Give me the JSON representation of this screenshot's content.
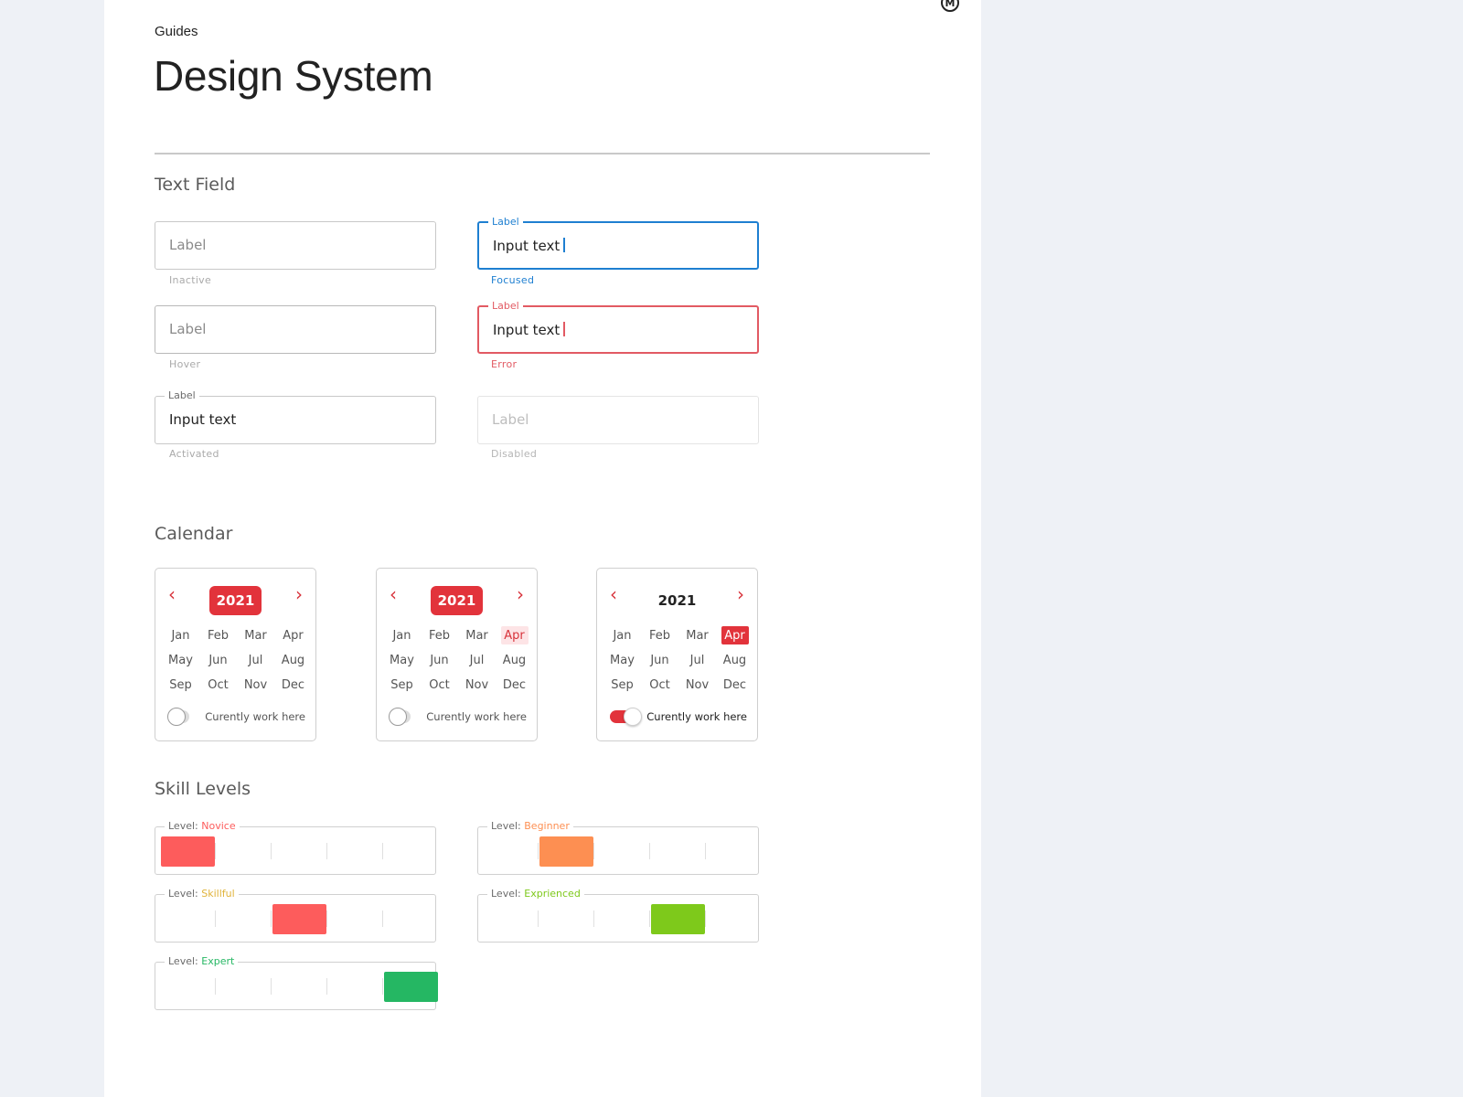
{
  "header": {
    "breadcrumb": "Guides",
    "title": "Design System",
    "logo_letter": "M"
  },
  "text_field_section": {
    "title": "Text Field",
    "fields": [
      {
        "state": "Inactive",
        "label": "Label",
        "value": "",
        "placeholder": "Label"
      },
      {
        "state": "Focused",
        "label": "Label",
        "value": "Input text",
        "placeholder": ""
      },
      {
        "state": "Hover",
        "label": "Label",
        "value": "",
        "placeholder": "Label"
      },
      {
        "state": "Error",
        "label": "Label",
        "value": "Input text",
        "placeholder": ""
      },
      {
        "state": "Activated",
        "label": "Label",
        "value": "Input text",
        "placeholder": ""
      },
      {
        "state": "Disabled",
        "label": "Label",
        "value": "",
        "placeholder": "Label"
      }
    ]
  },
  "calendar_section": {
    "title": "Calendar",
    "calendars": [
      {
        "year": "2021",
        "months": [
          "Jan",
          "Feb",
          "Mar",
          "Apr",
          "May",
          "Jun",
          "Jul",
          "Aug",
          "Sep",
          "Oct",
          "Nov",
          "Dec"
        ],
        "highlighted_month": "",
        "toggle_label": "Curently work here",
        "toggle_on": false
      },
      {
        "year": "2021",
        "months": [
          "Jan",
          "Feb",
          "Mar",
          "Apr",
          "May",
          "Jun",
          "Jul",
          "Aug",
          "Sep",
          "Oct",
          "Nov",
          "Dec"
        ],
        "highlighted_month": "Apr",
        "toggle_label": "Curently work here",
        "toggle_on": false
      },
      {
        "year": "2021",
        "months": [
          "Jan",
          "Feb",
          "Mar",
          "Apr",
          "May",
          "Jun",
          "Jul",
          "Aug",
          "Sep",
          "Oct",
          "Nov",
          "Dec"
        ],
        "highlighted_month": "Apr",
        "toggle_label": "Curently work here",
        "toggle_on": true
      }
    ]
  },
  "skill_section": {
    "title": "Skill Levels",
    "level_prefix": "Level:",
    "scale_steps": 5,
    "levels": [
      {
        "name": "Novice",
        "step": 1,
        "color": "#fd5c5c"
      },
      {
        "name": "Beginner",
        "step": 2,
        "color": "#fd8f52"
      },
      {
        "name": "Skillful",
        "step": 3,
        "color": "#fd5c5c",
        "label_color": "#e0b33a"
      },
      {
        "name": "Exprienced",
        "step": 4,
        "color": "#7ec91b"
      },
      {
        "name": "Expert",
        "step": 5,
        "color": "#25b763"
      }
    ]
  },
  "colors": {
    "accent_blue": "#1e7fd1",
    "error_red": "#e25a63",
    "calendar_red": "#e2333b",
    "novice": "#fd5c5c",
    "beginner": "#fd8f52",
    "skillful_label": "#e0b33a",
    "experienced": "#7ec91b",
    "expert": "#25b763"
  },
  "icons": {
    "prev": "chevron-left-icon",
    "next": "chevron-right-icon",
    "logo": "circle-m-logo"
  }
}
